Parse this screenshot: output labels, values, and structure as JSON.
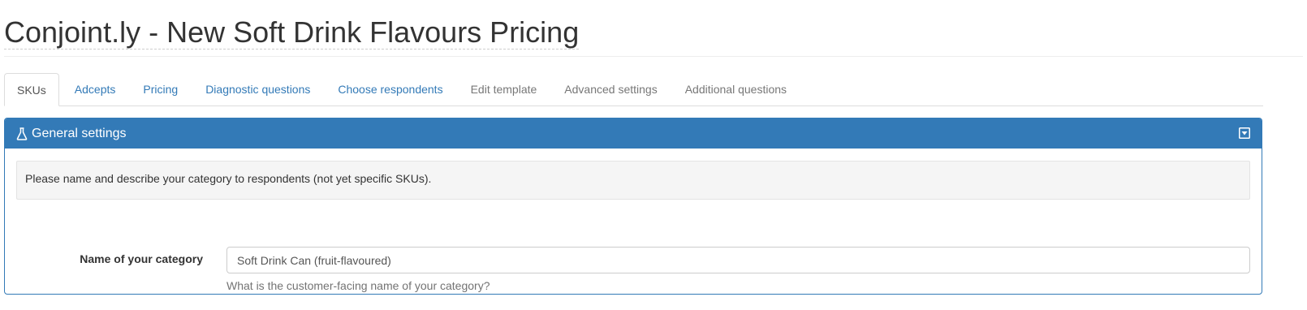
{
  "page": {
    "title": "Conjoint.ly - New Soft Drink Flavours Pricing"
  },
  "tabs": [
    {
      "label": "SKUs",
      "state": "active"
    },
    {
      "label": "Adcepts",
      "state": "link"
    },
    {
      "label": "Pricing",
      "state": "link"
    },
    {
      "label": "Diagnostic questions",
      "state": "link"
    },
    {
      "label": "Choose respondents",
      "state": "link"
    },
    {
      "label": "Edit template",
      "state": "muted"
    },
    {
      "label": "Advanced settings",
      "state": "muted"
    },
    {
      "label": "Additional questions",
      "state": "muted"
    }
  ],
  "panel": {
    "title": "General settings",
    "title_icon": "flask-icon",
    "collapse_icon": "collapse-toggle-icon",
    "accent_color": "#337ab7",
    "info_text": "Please name and describe your category to respondents (not yet specific SKUs).",
    "category_field": {
      "label": "Name of your category",
      "value": "Soft Drink Can (fruit-flavoured)",
      "help": "What is the customer-facing name of your category?"
    }
  }
}
